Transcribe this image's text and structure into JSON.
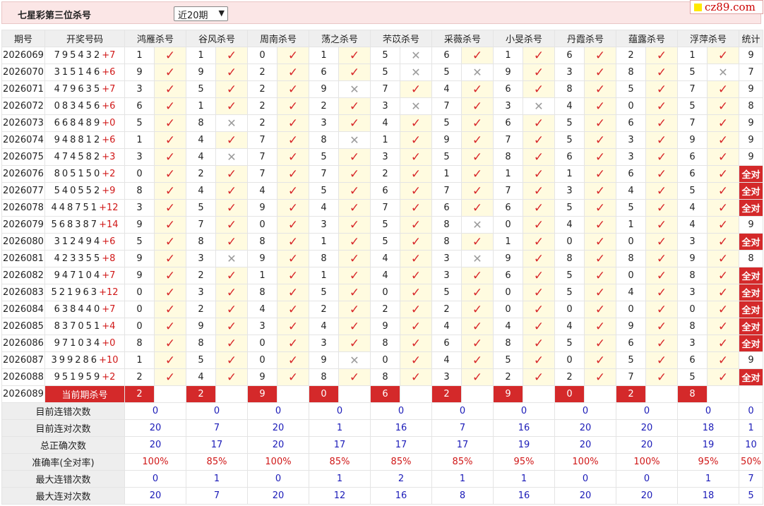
{
  "page": {
    "title": "七星彩第三位杀号",
    "select_value": "近20期",
    "brand": "cz89.com"
  },
  "headers": [
    "期号",
    "开奖号码",
    "鸿雁杀号",
    "谷风杀号",
    "周南杀号",
    "荡之杀号",
    "芣苡杀号",
    "采薇杀号",
    "小旻杀号",
    "丹霞杀号",
    "蕴露杀号",
    "浮萍杀号",
    "统计"
  ],
  "rows": [
    {
      "period": "2026069",
      "draw": "795432",
      "bonus": "+7",
      "picks": [
        "1",
        "1",
        "0",
        "1",
        "5",
        "6",
        "1",
        "6",
        "2",
        "1"
      ],
      "ok": [
        true,
        true,
        true,
        true,
        false,
        true,
        true,
        true,
        true,
        true
      ],
      "stat": "9"
    },
    {
      "period": "2026070",
      "draw": "315146",
      "bonus": "+6",
      "picks": [
        "9",
        "9",
        "2",
        "6",
        "5",
        "5",
        "9",
        "3",
        "8",
        "5"
      ],
      "ok": [
        true,
        true,
        true,
        true,
        false,
        false,
        true,
        true,
        true,
        false
      ],
      "stat": "7"
    },
    {
      "period": "2026071",
      "draw": "479635",
      "bonus": "+7",
      "picks": [
        "3",
        "5",
        "2",
        "9",
        "7",
        "4",
        "6",
        "8",
        "5",
        "7"
      ],
      "ok": [
        true,
        true,
        true,
        false,
        true,
        true,
        true,
        true,
        true,
        true
      ],
      "stat": "9"
    },
    {
      "period": "2026072",
      "draw": "083456",
      "bonus": "+6",
      "picks": [
        "6",
        "1",
        "2",
        "2",
        "3",
        "7",
        "3",
        "4",
        "0",
        "5"
      ],
      "ok": [
        true,
        true,
        true,
        true,
        false,
        true,
        false,
        true,
        true,
        true
      ],
      "stat": "8"
    },
    {
      "period": "2026073",
      "draw": "668489",
      "bonus": "+0",
      "picks": [
        "5",
        "8",
        "2",
        "3",
        "4",
        "5",
        "6",
        "5",
        "6",
        "7"
      ],
      "ok": [
        true,
        false,
        true,
        true,
        true,
        true,
        true,
        true,
        true,
        true
      ],
      "stat": "9"
    },
    {
      "period": "2026074",
      "draw": "948812",
      "bonus": "+6",
      "picks": [
        "1",
        "4",
        "7",
        "8",
        "1",
        "9",
        "7",
        "5",
        "3",
        "9"
      ],
      "ok": [
        true,
        true,
        true,
        false,
        true,
        true,
        true,
        true,
        true,
        true
      ],
      "stat": "9"
    },
    {
      "period": "2026075",
      "draw": "474582",
      "bonus": "+3",
      "picks": [
        "3",
        "4",
        "7",
        "5",
        "3",
        "5",
        "8",
        "6",
        "3",
        "6"
      ],
      "ok": [
        true,
        false,
        true,
        true,
        true,
        true,
        true,
        true,
        true,
        true
      ],
      "stat": "9"
    },
    {
      "period": "2026076",
      "draw": "805150",
      "bonus": "+2",
      "picks": [
        "0",
        "2",
        "7",
        "7",
        "2",
        "1",
        "1",
        "1",
        "6",
        "6"
      ],
      "ok": [
        true,
        true,
        true,
        true,
        true,
        true,
        true,
        true,
        true,
        true
      ],
      "stat": "全对"
    },
    {
      "period": "2026077",
      "draw": "540552",
      "bonus": "+9",
      "picks": [
        "8",
        "4",
        "4",
        "5",
        "6",
        "7",
        "7",
        "3",
        "4",
        "5"
      ],
      "ok": [
        true,
        true,
        true,
        true,
        true,
        true,
        true,
        true,
        true,
        true
      ],
      "stat": "全对"
    },
    {
      "period": "2026078",
      "draw": "448751",
      "bonus": "+12",
      "picks": [
        "3",
        "5",
        "9",
        "4",
        "7",
        "6",
        "6",
        "5",
        "5",
        "4"
      ],
      "ok": [
        true,
        true,
        true,
        true,
        true,
        true,
        true,
        true,
        true,
        true
      ],
      "stat": "全对"
    },
    {
      "period": "2026079",
      "draw": "568387",
      "bonus": "+14",
      "picks": [
        "9",
        "7",
        "0",
        "3",
        "5",
        "8",
        "0",
        "4",
        "1",
        "4"
      ],
      "ok": [
        true,
        true,
        true,
        true,
        true,
        false,
        true,
        true,
        true,
        true
      ],
      "stat": "9"
    },
    {
      "period": "2026080",
      "draw": "312494",
      "bonus": "+6",
      "picks": [
        "5",
        "8",
        "8",
        "1",
        "5",
        "8",
        "1",
        "0",
        "0",
        "3"
      ],
      "ok": [
        true,
        true,
        true,
        true,
        true,
        true,
        true,
        true,
        true,
        true
      ],
      "stat": "全对"
    },
    {
      "period": "2026081",
      "draw": "423355",
      "bonus": "+8",
      "picks": [
        "9",
        "3",
        "9",
        "8",
        "4",
        "3",
        "9",
        "8",
        "8",
        "9"
      ],
      "ok": [
        true,
        false,
        true,
        true,
        true,
        false,
        true,
        true,
        true,
        true
      ],
      "stat": "8"
    },
    {
      "period": "2026082",
      "draw": "947104",
      "bonus": "+7",
      "picks": [
        "9",
        "2",
        "1",
        "1",
        "4",
        "3",
        "6",
        "5",
        "0",
        "8"
      ],
      "ok": [
        true,
        true,
        true,
        true,
        true,
        true,
        true,
        true,
        true,
        true
      ],
      "stat": "全对"
    },
    {
      "period": "2026083",
      "draw": "521963",
      "bonus": "+12",
      "picks": [
        "0",
        "3",
        "8",
        "5",
        "0",
        "5",
        "0",
        "5",
        "4",
        "3"
      ],
      "ok": [
        true,
        true,
        true,
        true,
        true,
        true,
        true,
        true,
        true,
        true
      ],
      "stat": "全对"
    },
    {
      "period": "2026084",
      "draw": "638440",
      "bonus": "+7",
      "picks": [
        "0",
        "2",
        "4",
        "2",
        "2",
        "2",
        "0",
        "0",
        "0",
        "0"
      ],
      "ok": [
        true,
        true,
        true,
        true,
        true,
        true,
        true,
        true,
        true,
        true
      ],
      "stat": "全对"
    },
    {
      "period": "2026085",
      "draw": "837051",
      "bonus": "+4",
      "picks": [
        "0",
        "9",
        "3",
        "4",
        "9",
        "4",
        "4",
        "4",
        "9",
        "8"
      ],
      "ok": [
        true,
        true,
        true,
        true,
        true,
        true,
        true,
        true,
        true,
        true
      ],
      "stat": "全对"
    },
    {
      "period": "2026086",
      "draw": "971034",
      "bonus": "+0",
      "picks": [
        "8",
        "8",
        "0",
        "3",
        "8",
        "6",
        "8",
        "5",
        "6",
        "3"
      ],
      "ok": [
        true,
        true,
        true,
        true,
        true,
        true,
        true,
        true,
        true,
        true
      ],
      "stat": "全对"
    },
    {
      "period": "2026087",
      "draw": "399286",
      "bonus": "+10",
      "picks": [
        "1",
        "5",
        "0",
        "9",
        "0",
        "4",
        "5",
        "0",
        "5",
        "6"
      ],
      "ok": [
        true,
        true,
        true,
        false,
        true,
        true,
        true,
        true,
        true,
        true
      ],
      "stat": "9"
    },
    {
      "period": "2026088",
      "draw": "951959",
      "bonus": "+2",
      "picks": [
        "2",
        "4",
        "9",
        "8",
        "8",
        "3",
        "2",
        "2",
        "7",
        "5"
      ],
      "ok": [
        true,
        true,
        true,
        true,
        true,
        true,
        true,
        true,
        true,
        true
      ],
      "stat": "全对"
    }
  ],
  "current": {
    "period": "2026089",
    "label": "当前期杀号",
    "picks": [
      "2",
      "2",
      "9",
      "0",
      "6",
      "2",
      "9",
      "0",
      "2",
      "8"
    ]
  },
  "summary": [
    {
      "label": "目前连错次数",
      "values": [
        "0",
        "0",
        "0",
        "0",
        "0",
        "0",
        "0",
        "0",
        "0",
        "0",
        "0"
      ],
      "color": "blue"
    },
    {
      "label": "目前连对次数",
      "values": [
        "20",
        "7",
        "20",
        "1",
        "16",
        "7",
        "16",
        "20",
        "20",
        "18",
        "1"
      ],
      "color": "blue"
    },
    {
      "label": "总正确次数",
      "values": [
        "20",
        "17",
        "20",
        "17",
        "17",
        "17",
        "19",
        "20",
        "20",
        "19",
        "10"
      ],
      "color": "blue"
    },
    {
      "label": "准确率(全对率)",
      "values": [
        "100%",
        "85%",
        "100%",
        "85%",
        "85%",
        "85%",
        "95%",
        "100%",
        "100%",
        "95%",
        "50%"
      ],
      "color": "red"
    },
    {
      "label": "最大连错次数",
      "values": [
        "0",
        "1",
        "0",
        "1",
        "2",
        "1",
        "1",
        "0",
        "0",
        "1",
        "7"
      ],
      "color": "blue"
    },
    {
      "label": "最大连对次数",
      "values": [
        "20",
        "7",
        "20",
        "12",
        "16",
        "8",
        "16",
        "20",
        "20",
        "18",
        "5"
      ],
      "color": "blue"
    }
  ],
  "icons": {
    "correct": "check-icon",
    "wrong": "cross-icon"
  },
  "colors": {
    "accent_red": "#d4292a",
    "stat_blue": "#1b1bb8",
    "mark_bg": "#fffbe0",
    "header_bg": "#fbe6e6"
  }
}
